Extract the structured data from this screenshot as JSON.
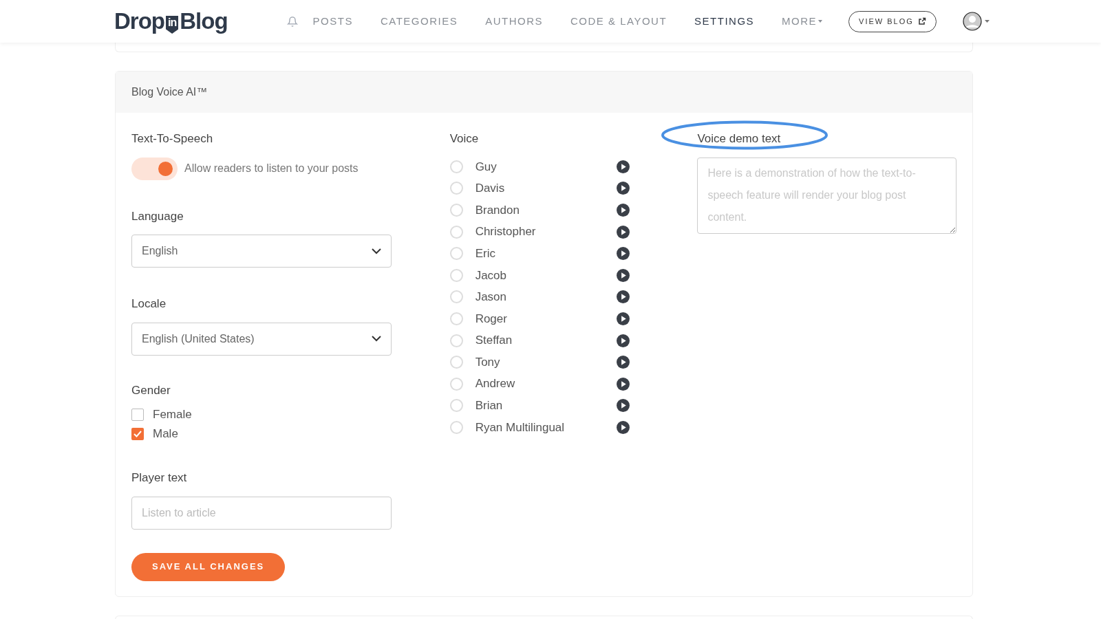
{
  "logo": {
    "left": "Drop",
    "badge": "in",
    "right": "Blog"
  },
  "nav": [
    {
      "label": "POSTS",
      "selected": false,
      "dropdown": false
    },
    {
      "label": "CATEGORIES",
      "selected": false,
      "dropdown": false
    },
    {
      "label": "AUTHORS",
      "selected": false,
      "dropdown": false
    },
    {
      "label": "CODE & LAYOUT",
      "selected": false,
      "dropdown": false
    },
    {
      "label": "SETTINGS",
      "selected": true,
      "dropdown": false
    },
    {
      "label": "MORE",
      "selected": false,
      "dropdown": true
    }
  ],
  "view_blog": "VIEW BLOG",
  "card": {
    "title": "Blog Voice AI™",
    "tts": {
      "label": "Text-To-Speech",
      "on": true,
      "text": "Allow readers to listen to your posts"
    },
    "language": {
      "label": "Language",
      "value": "English"
    },
    "locale": {
      "label": "Locale",
      "value": "English (United States)"
    },
    "gender": {
      "label": "Gender",
      "options": [
        {
          "label": "Female",
          "checked": false
        },
        {
          "label": "Male",
          "checked": true
        }
      ]
    },
    "player_text": {
      "label": "Player text",
      "placeholder": "Listen to article"
    },
    "save": "SAVE ALL CHANGES",
    "voice": {
      "label": "Voice",
      "options": [
        {
          "name": "Guy",
          "selected": false
        },
        {
          "name": "Davis",
          "selected": false
        },
        {
          "name": "Brandon",
          "selected": false
        },
        {
          "name": "Christopher",
          "selected": false
        },
        {
          "name": "Eric",
          "selected": false
        },
        {
          "name": "Jacob",
          "selected": false
        },
        {
          "name": "Jason",
          "selected": false
        },
        {
          "name": "Roger",
          "selected": false
        },
        {
          "name": "Steffan",
          "selected": false
        },
        {
          "name": "Tony",
          "selected": false
        },
        {
          "name": "Andrew",
          "selected": false
        },
        {
          "name": "Brian",
          "selected": false
        },
        {
          "name": "Ryan Multilingual",
          "selected": false
        }
      ]
    },
    "demo": {
      "label": "Voice demo text",
      "circled": true,
      "placeholder": "Here is a demonstration of how the text-to-speech feature will render your blog post content."
    }
  }
}
